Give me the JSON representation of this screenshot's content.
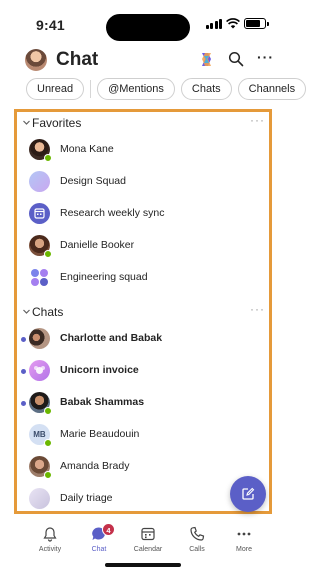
{
  "status_bar": {
    "time": "9:41",
    "battery_level": 0.8
  },
  "header": {
    "title": "Chat",
    "icons": [
      "avatar",
      "copilot-icon",
      "search-icon",
      "more-icon"
    ],
    "more_label": "···"
  },
  "filters": [
    {
      "label": "Unread"
    },
    {
      "label": "@Mentions"
    },
    {
      "label": "Chats"
    },
    {
      "label": "Channels"
    }
  ],
  "favorites": {
    "title": "Favorites",
    "more": "···",
    "items": [
      {
        "label": "Mona Kane",
        "icon": "person-avatar",
        "presence": "available"
      },
      {
        "label": "Design Squad",
        "icon": "group-avatar"
      },
      {
        "label": "Research weekly sync",
        "icon": "calendar-icon"
      },
      {
        "label": "Danielle Booker",
        "icon": "person-avatar",
        "presence": "available"
      },
      {
        "label": "Engineering squad",
        "icon": "group-avatar"
      }
    ]
  },
  "chats": {
    "title": "Chats",
    "more": "···",
    "items": [
      {
        "label": "Charlotte and Babak",
        "unread": true,
        "icon": "group-avatar"
      },
      {
        "label": "Unicorn invoice",
        "unread": true,
        "icon": "group-avatar"
      },
      {
        "label": "Babak Shammas",
        "unread": true,
        "icon": "person-avatar",
        "presence": "available"
      },
      {
        "label": "Marie Beaudouin",
        "unread": false,
        "initials": "MB",
        "presence": "available"
      },
      {
        "label": "Amanda Brady",
        "unread": false,
        "icon": "person-avatar",
        "presence": "available"
      },
      {
        "label": "Daily triage",
        "unread": false,
        "icon": "group-avatar"
      }
    ]
  },
  "tabbar": {
    "tabs": [
      {
        "label": "Activity",
        "icon": "bell-icon"
      },
      {
        "label": "Chat",
        "icon": "chat-icon",
        "badge": "4",
        "active": true
      },
      {
        "label": "Calendar",
        "icon": "calendar-icon"
      },
      {
        "label": "Calls",
        "icon": "phone-icon"
      },
      {
        "label": "More",
        "icon": "more-icon"
      }
    ]
  },
  "colors": {
    "accent": "#5b5fc7",
    "highlight": "#e59a3a",
    "presence": "#6bb700",
    "badge": "#c4314b"
  }
}
